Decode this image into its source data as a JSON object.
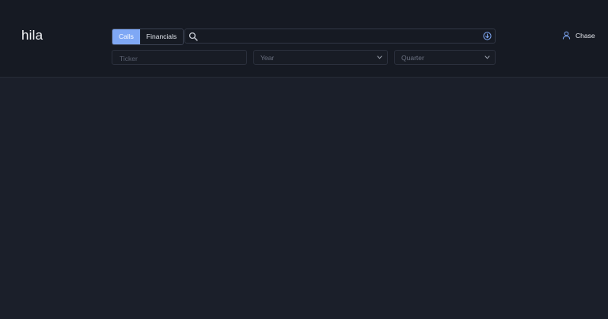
{
  "app": {
    "logo": "hila"
  },
  "toggle": {
    "calls_label": "Calls",
    "financials_label": "Financials",
    "active": "Calls"
  },
  "search": {
    "value": "",
    "placeholder": ""
  },
  "filters": {
    "ticker_placeholder": "Ticker",
    "year_label": "Year",
    "quarter_label": "Quarter"
  },
  "user": {
    "name": "Chase"
  },
  "colors": {
    "accent": "#7fa8f5",
    "header_bg": "#161a23",
    "page_bg": "#1b1f2a"
  },
  "icons": {
    "search": "search-icon",
    "go": "arrow-down-circle-icon",
    "chevron": "chevron-down-icon",
    "user": "user-icon"
  }
}
